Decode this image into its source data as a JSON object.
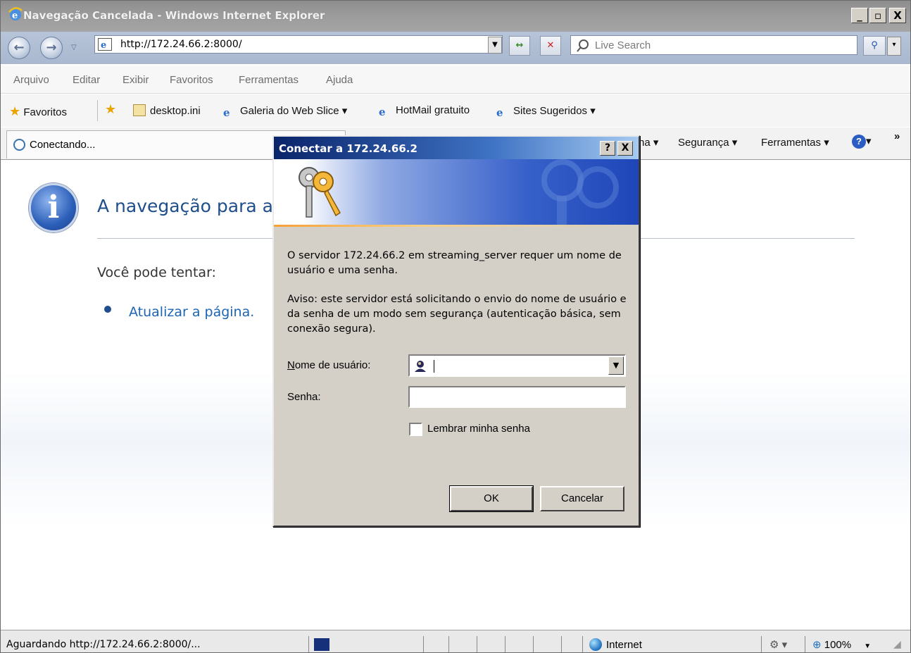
{
  "window": {
    "title": "Navegação Cancelada - Windows Internet Explorer",
    "minimize": "_",
    "maximize": "▫",
    "close": "X"
  },
  "address_bar": {
    "url": "http://172.24.66.2:8000/",
    "search_placeholder": "Live Search"
  },
  "menu": [
    "Arquivo",
    "Editar",
    "Exibir",
    "Favoritos",
    "Ferramentas",
    "Ajuda"
  ],
  "favorites_bar": {
    "favorites_label": "Favoritos",
    "items": [
      "desktop.ini",
      "Galeria do Web Slice ▾",
      "HotMail gratuito",
      "Sites Sugeridos ▾"
    ]
  },
  "tab": {
    "label": "Conectando..."
  },
  "command_bar": {
    "page_partial": "na ▾",
    "security": "Segurança ▾",
    "tools": "Ferramentas ▾",
    "help": "▾",
    "overflow": "»"
  },
  "page": {
    "heading": "A navegação para a",
    "try_text": "Você pode tentar:",
    "refresh_link": "Atualizar a página."
  },
  "status_bar": {
    "text": "Aguardando http://172.24.66.2:8000/...",
    "zone": "Internet",
    "zoom": "100%"
  },
  "dialog": {
    "title": "Conectar a 172.24.66.2",
    "help_btn": "?",
    "close_btn": "X",
    "message": "O servidor 172.24.66.2 em streaming_server requer um nome de usuário e uma senha.",
    "warning": "Aviso: este servidor está solicitando o envio do nome de usuário e da senha de um modo sem segurança (autenticação básica, sem conexão segura).",
    "username_label": "Nome de usuário:",
    "password_label": "Senha:",
    "remember_label": "Lembrar minha senha",
    "username_value": "",
    "password_value": "",
    "remember_checked": false,
    "ok": "OK",
    "cancel": "Cancelar"
  }
}
